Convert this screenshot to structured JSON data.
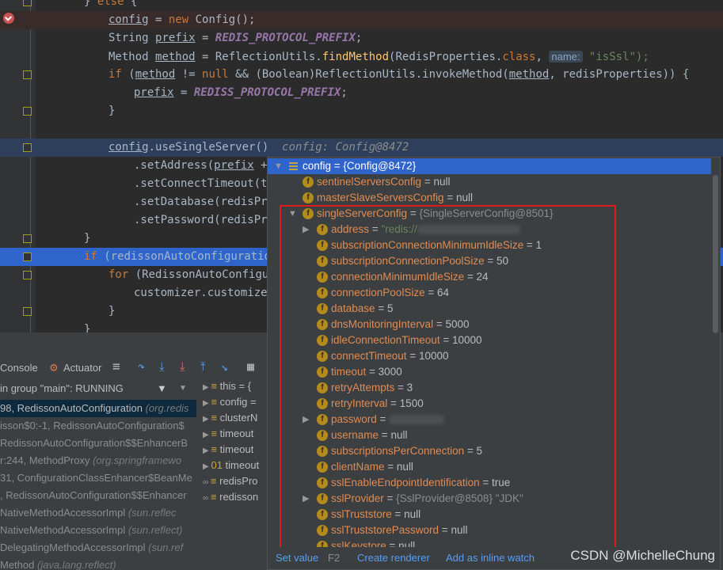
{
  "editor": {
    "lines": [
      {
        "id": "else",
        "kind": "plain",
        "parts": [
          [
            "} ",
            "p"
          ],
          [
            "else",
            " kw"
          ],
          [
            " {",
            "p"
          ]
        ]
      },
      {
        "id": "config-new",
        "kind": "hl",
        "parts": [
          [
            "config",
            "var"
          ],
          [
            " = ",
            "p"
          ],
          [
            "new",
            " kw"
          ],
          [
            " Config();",
            "p"
          ]
        ]
      },
      {
        "id": "prefix",
        "kind": "plain",
        "parts": [
          [
            "String ",
            "p"
          ],
          [
            "prefix",
            "var"
          ],
          [
            " = ",
            "p"
          ],
          [
            "REDIS_PROTOCOL_PREFIX",
            "fld"
          ],
          [
            ";",
            "p"
          ]
        ]
      },
      {
        "id": "method",
        "kind": "plain",
        "parts": [
          [
            "Method ",
            "p"
          ],
          [
            "method",
            "var"
          ],
          [
            " = ReflectionUtils.",
            "p"
          ],
          [
            "findMethod",
            "p"
          ],
          [
            "(RedisProperties.",
            "p"
          ],
          [
            "class",
            "kw"
          ],
          [
            ", ",
            "p"
          ]
        ]
      },
      {
        "id": "if-method",
        "kind": "plain",
        "parts": [
          [
            "if",
            " kw"
          ],
          [
            " (",
            "p"
          ],
          [
            "method",
            "var"
          ],
          [
            " != ",
            "p"
          ],
          [
            "null",
            "kw"
          ],
          [
            " && (Boolean)ReflectionUtils.invokeMethod(",
            "p"
          ],
          [
            "method",
            "var"
          ],
          [
            ", redisProperties)) {",
            "p"
          ]
        ]
      },
      {
        "id": "prefix2",
        "kind": "plain",
        "parts": [
          [
            "prefix",
            "var"
          ],
          [
            " = ",
            "p"
          ],
          [
            "REDISS_PROTOCOL_PREFIX",
            "fld"
          ],
          [
            ";",
            "p"
          ]
        ]
      },
      {
        "id": "close1",
        "kind": "plain",
        "parts": [
          [
            "}",
            "p"
          ]
        ]
      },
      {
        "id": "blank",
        "kind": "plain",
        "parts": []
      },
      {
        "id": "useSingle",
        "kind": "cur",
        "parts": [
          [
            "config",
            "var"
          ],
          [
            ".useSingleServer()",
            "p"
          ]
        ]
      },
      {
        "id": "setAddress",
        "kind": "plain",
        "parts": [
          [
            ".setAddress(",
            "p"
          ],
          [
            "prefix",
            "var"
          ],
          [
            " + ",
            "p"
          ]
        ]
      },
      {
        "id": "setConnectTimeout",
        "kind": "plain",
        "parts": [
          [
            ".setConnectTimeout(ti",
            "p"
          ]
        ]
      },
      {
        "id": "setDatabase",
        "kind": "plain",
        "parts": [
          [
            ".setDatabase(redisPro",
            "p"
          ]
        ]
      },
      {
        "id": "setPassword",
        "kind": "plain",
        "parts": [
          [
            ".setPassword(redisPro",
            "p"
          ]
        ]
      },
      {
        "id": "close2",
        "kind": "plain",
        "parts": [
          [
            "}",
            "p"
          ]
        ]
      },
      {
        "id": "if-redisson",
        "kind": "exec",
        "parts": [
          [
            "if",
            " kw"
          ],
          [
            " (redissonAutoConfiguration",
            "p"
          ]
        ]
      },
      {
        "id": "for",
        "kind": "plain",
        "parts": [
          [
            "for",
            " kw"
          ],
          [
            " (RedissonAutoConfigur",
            "p"
          ]
        ]
      },
      {
        "id": "customizer",
        "kind": "plain",
        "parts": [
          [
            "customizer.customize(",
            "p"
          ]
        ]
      },
      {
        "id": "close3",
        "kind": "plain",
        "parts": [
          [
            "}",
            "p"
          ]
        ]
      },
      {
        "id": "close4",
        "kind": "plain",
        "parts": [
          [
            "}",
            "p"
          ]
        ]
      }
    ],
    "hint_name": "name:",
    "hint_value": "\"isSsl\");",
    "inline_debug": "config: Config@8472"
  },
  "panel": {
    "tab_console": "Console",
    "tab_actuator": "Actuator",
    "thread": "in group \"main\": RUNNING",
    "frames": [
      {
        "text": "98, RedissonAutoConfiguration ",
        "italic": "(org.redis",
        "sel": true
      },
      {
        "text": "isson$0:-1, RedissonAutoConfiguration$",
        "italic": "",
        "sel": false
      },
      {
        "text": "RedissonAutoConfiguration$$EnhancerB",
        "italic": "",
        "sel": false
      },
      {
        "text": "r:244, MethodProxy ",
        "italic": "(org.springframewo",
        "sel": false
      },
      {
        "text": "31, ConfigurationClassEnhancer$BeanMe",
        "italic": "",
        "sel": false
      },
      {
        "text": ", RedissonAutoConfiguration$$Enhancer",
        "italic": "",
        "sel": false
      },
      {
        "text": " NativeMethodAccessorImpl ",
        "italic": "(sun.reflec",
        "sel": false
      },
      {
        "text": "NativeMethodAccessorImpl ",
        "italic": "(sun.reflect)",
        "sel": false
      },
      {
        "text": "DelegatingMethodAccessorImpl ",
        "italic": "(sun.ref",
        "sel": false
      },
      {
        "text": " Method ",
        "italic": "(java.lang.reflect)",
        "sel": false
      }
    ],
    "variables": [
      "this = {",
      "config =",
      "clusterN",
      "timeout",
      "timeout",
      "timeout",
      "redisPro",
      "redisson"
    ]
  },
  "popup": {
    "rows": [
      {
        "indent": 0,
        "arrow": "▼",
        "icon": "list",
        "name": "config",
        "eq": " = ",
        "val": "{Config@8472}",
        "vtype": "plain",
        "sel": true
      },
      {
        "indent": 1,
        "arrow": "",
        "icon": "f",
        "name": "sentinelServersConfig",
        "eq": " = ",
        "val": "null",
        "vtype": "plain",
        "sel": false
      },
      {
        "indent": 1,
        "arrow": "",
        "icon": "f",
        "name": "masterSlaveServersConfig",
        "eq": " = ",
        "val": "null",
        "vtype": "plain",
        "sel": false
      },
      {
        "indent": 1,
        "arrow": "▼",
        "icon": "f",
        "name": "singleServerConfig",
        "eq": " = ",
        "val": "{SingleServerConfig@8501}",
        "vtype": "ref",
        "sel": false
      },
      {
        "indent": 2,
        "arrow": "▶",
        "icon": "f",
        "name": "address",
        "eq": " = ",
        "val": "\"redis://",
        "vtype": "str-blur",
        "sel": false
      },
      {
        "indent": 2,
        "arrow": "",
        "icon": "f",
        "name": "subscriptionConnectionMinimumIdleSize",
        "eq": " = ",
        "val": "1",
        "vtype": "plain",
        "sel": false
      },
      {
        "indent": 2,
        "arrow": "",
        "icon": "f",
        "name": "subscriptionConnectionPoolSize",
        "eq": " = ",
        "val": "50",
        "vtype": "plain",
        "sel": false
      },
      {
        "indent": 2,
        "arrow": "",
        "icon": "f",
        "name": "connectionMinimumIdleSize",
        "eq": " = ",
        "val": "24",
        "vtype": "plain",
        "sel": false
      },
      {
        "indent": 2,
        "arrow": "",
        "icon": "f",
        "name": "connectionPoolSize",
        "eq": " = ",
        "val": "64",
        "vtype": "plain",
        "sel": false
      },
      {
        "indent": 2,
        "arrow": "",
        "icon": "f",
        "name": "database",
        "eq": " = ",
        "val": "5",
        "vtype": "plain",
        "sel": false
      },
      {
        "indent": 2,
        "arrow": "",
        "icon": "f",
        "name": "dnsMonitoringInterval",
        "eq": " = ",
        "val": "5000",
        "vtype": "plain",
        "sel": false
      },
      {
        "indent": 2,
        "arrow": "",
        "icon": "f",
        "name": "idleConnectionTimeout",
        "eq": " = ",
        "val": "10000",
        "vtype": "plain",
        "sel": false
      },
      {
        "indent": 2,
        "arrow": "",
        "icon": "f",
        "name": "connectTimeout",
        "eq": " = ",
        "val": "10000",
        "vtype": "plain",
        "sel": false
      },
      {
        "indent": 2,
        "arrow": "",
        "icon": "f",
        "name": "timeout",
        "eq": " = ",
        "val": "3000",
        "vtype": "plain",
        "sel": false
      },
      {
        "indent": 2,
        "arrow": "",
        "icon": "f",
        "name": "retryAttempts",
        "eq": " = ",
        "val": "3",
        "vtype": "plain",
        "sel": false
      },
      {
        "indent": 2,
        "arrow": "",
        "icon": "f",
        "name": "retryInterval",
        "eq": " = ",
        "val": "1500",
        "vtype": "plain",
        "sel": false
      },
      {
        "indent": 2,
        "arrow": "▶",
        "icon": "f",
        "name": "password",
        "eq": " = ",
        "val": "",
        "vtype": "blur",
        "sel": false
      },
      {
        "indent": 2,
        "arrow": "",
        "icon": "f",
        "name": "username",
        "eq": " = ",
        "val": "null",
        "vtype": "plain",
        "sel": false
      },
      {
        "indent": 2,
        "arrow": "",
        "icon": "f",
        "name": "subscriptionsPerConnection",
        "eq": " = ",
        "val": "5",
        "vtype": "plain",
        "sel": false
      },
      {
        "indent": 2,
        "arrow": "",
        "icon": "f",
        "name": "clientName",
        "eq": " = ",
        "val": "null",
        "vtype": "plain",
        "sel": false
      },
      {
        "indent": 2,
        "arrow": "",
        "icon": "f",
        "name": "sslEnableEndpointIdentification",
        "eq": " = ",
        "val": "true",
        "vtype": "plain",
        "sel": false
      },
      {
        "indent": 2,
        "arrow": "▶",
        "icon": "f",
        "name": "sslProvider",
        "eq": " = ",
        "val": "{SslProvider@8508} \"JDK\"",
        "vtype": "ref",
        "sel": false
      },
      {
        "indent": 2,
        "arrow": "",
        "icon": "f",
        "name": "sslTruststore",
        "eq": " = ",
        "val": "null",
        "vtype": "plain",
        "sel": false
      },
      {
        "indent": 2,
        "arrow": "",
        "icon": "f",
        "name": "sslTruststorePassword",
        "eq": " = ",
        "val": "null",
        "vtype": "plain",
        "sel": false
      },
      {
        "indent": 2,
        "arrow": "",
        "icon": "f",
        "name": "sslKeystore",
        "eq": " = ",
        "val": "null",
        "vtype": "plain",
        "sel": false
      }
    ],
    "footer": {
      "set_value": "Set value",
      "set_value_key": "F2",
      "create_renderer": "Create renderer",
      "add_watch": "Add as inline watch"
    }
  },
  "watermark": "CSDN @MichelleChung",
  "colors": {
    "accent": "#2f65ca",
    "redbox": "#e01a1a"
  }
}
